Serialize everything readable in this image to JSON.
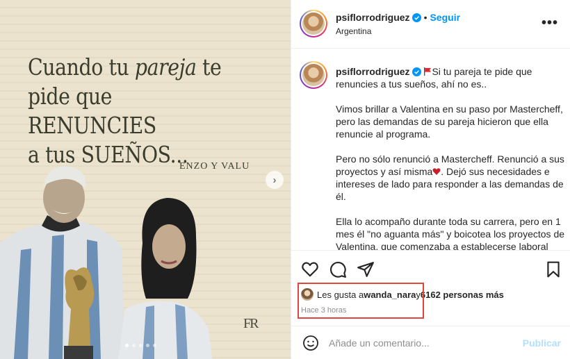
{
  "post_image": {
    "headline": {
      "line1_a": "Cuando tu ",
      "line1_italic": "pareja",
      "line1_b": " te",
      "line2": "pide que RENUNCIES",
      "line3": "a tus SUEÑOS..."
    },
    "names": "ENZO Y VALU",
    "brand_mark": "FR",
    "next_icon": "chevron-right-icon"
  },
  "header": {
    "username": "psiflorrodriguez",
    "separator": "•",
    "follow_label": "Seguir",
    "location": "Argentina",
    "more_label": "•••"
  },
  "caption": {
    "username": "psiflorrodriguez",
    "first_line": "Si tu pareja te pide que renuncies a tus sueños, ahí no es..",
    "paragraph1": "Vimos brillar a Valentina en su paso por Mastercheff, pero las demandas de su pareja hicieron que ella renuncie al programa.",
    "paragraph2_a": "Pero no sólo renunció a Mastercheff. Renunció a sus proyectos y así misma",
    "paragraph2_b": ". Dejó sus necesidades e intereses de lado para responder a las demandas de él.",
    "paragraph3": "Ella lo acompaño durante toda su carrera, pero en 1 mes él \"no aguanta más\" y boicotea los proyectos de Valentina, que comenzaba a establecerse laboral"
  },
  "likes": {
    "prefix": "Les gusta a ",
    "user": "wanda_nara",
    "middle": " y ",
    "count": "6162 personas más"
  },
  "time_ago": "Hace 3 horas",
  "comment": {
    "placeholder": "Añade un comentario...",
    "publish_label": "Publicar"
  },
  "colors": {
    "accent": "#0095f6",
    "highlight_box": "#e0453e",
    "image_bg": "#ece3cf"
  }
}
